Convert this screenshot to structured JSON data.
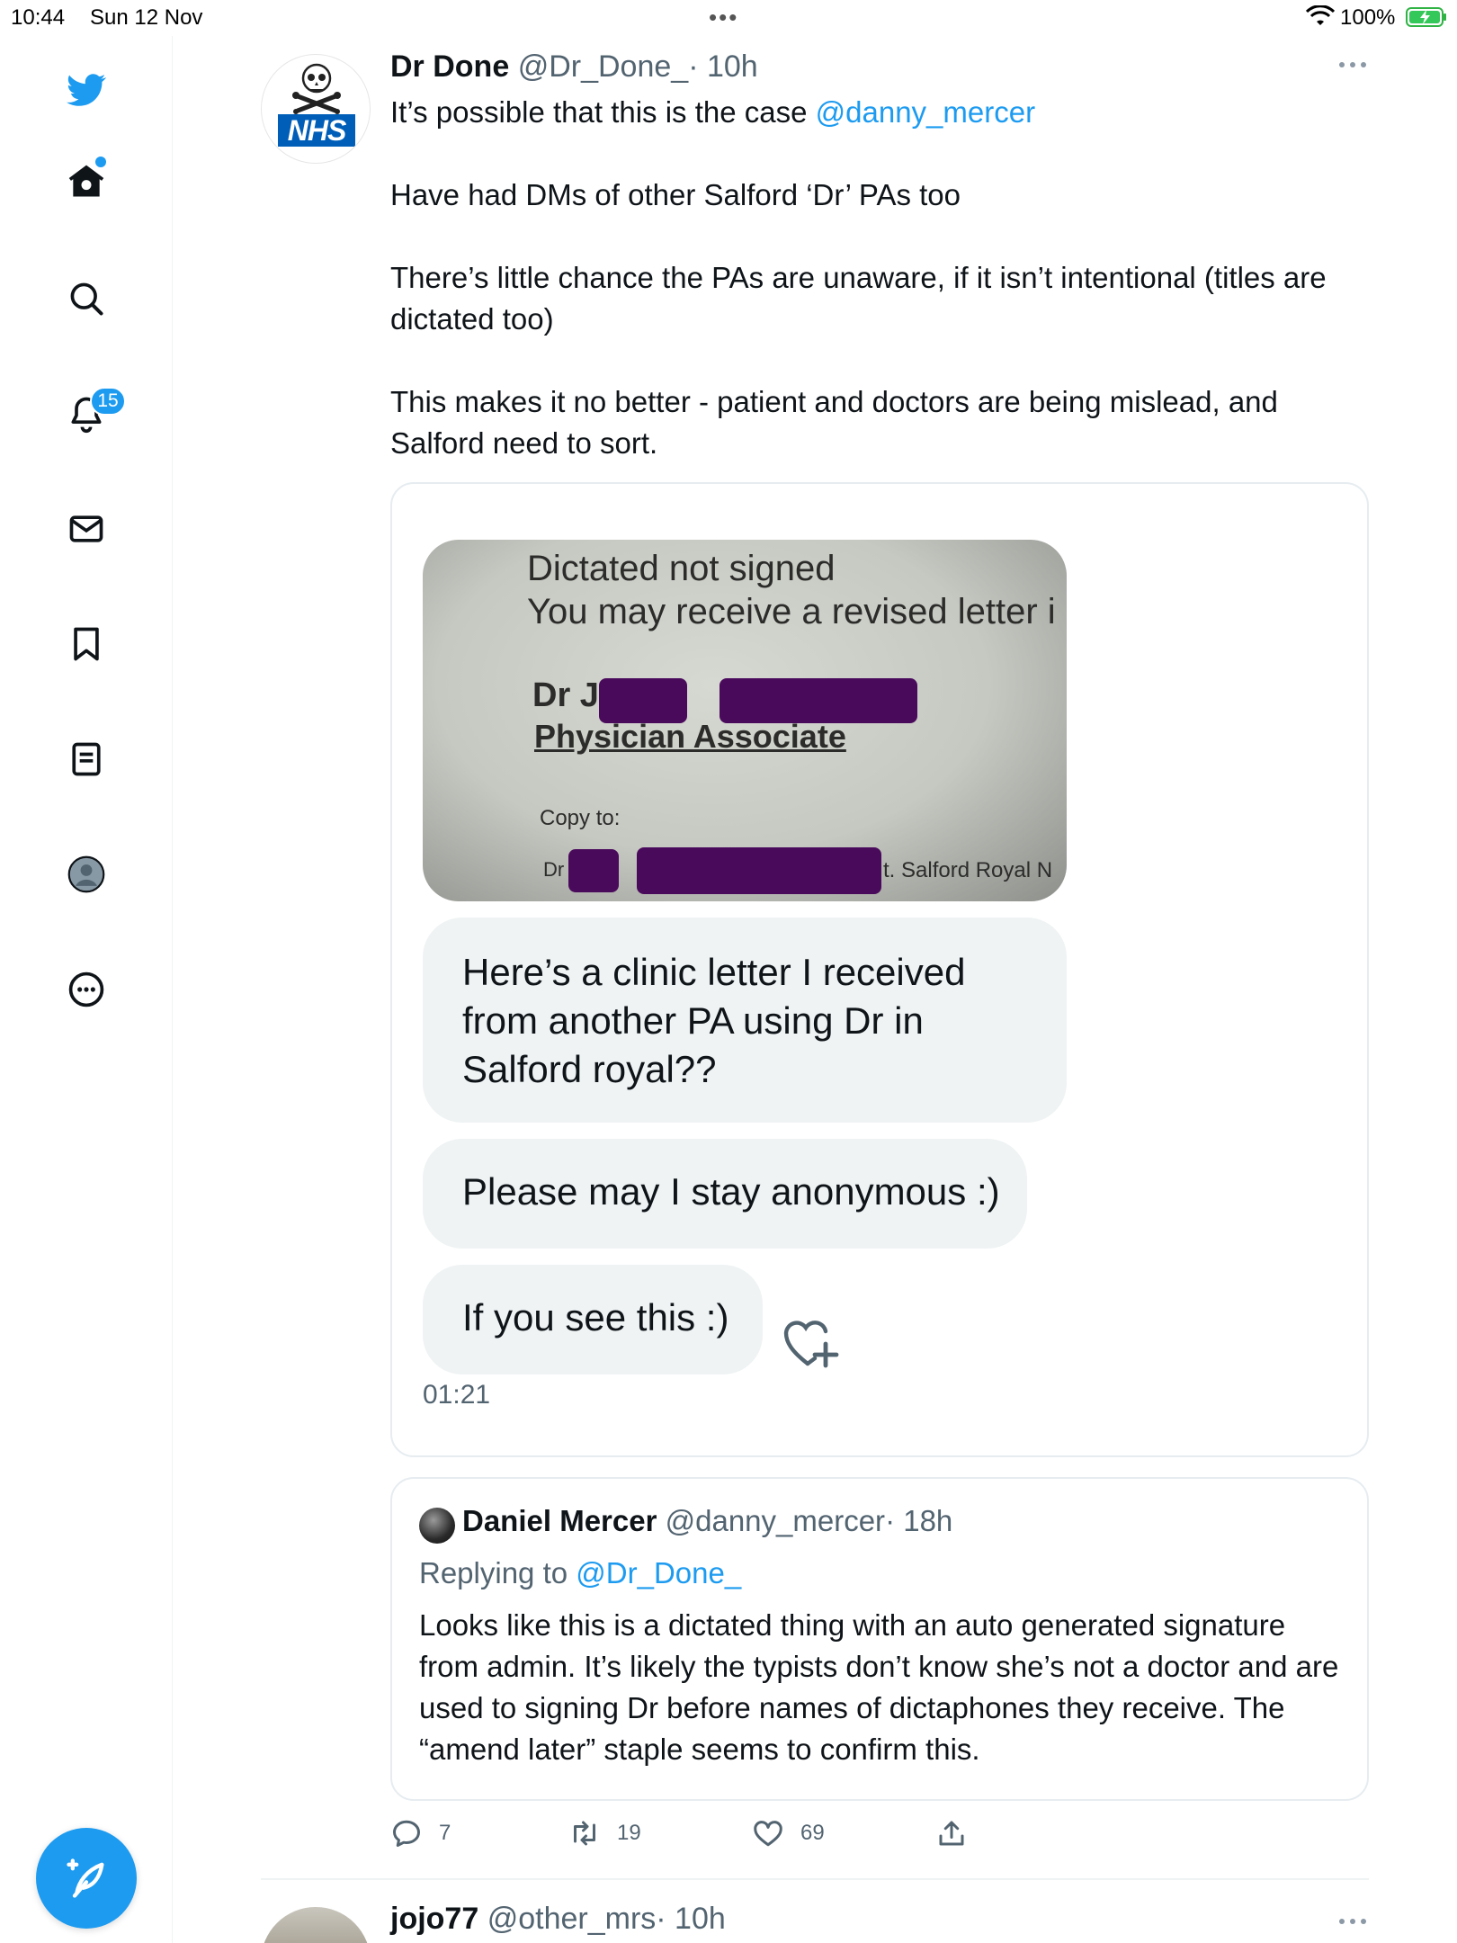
{
  "status_bar": {
    "time": "10:44",
    "date": "Sun 12 Nov",
    "battery": "100%"
  },
  "sidebar": {
    "notification_count": "15",
    "items": [
      {
        "name": "twitter-logo-icon"
      },
      {
        "name": "home-icon"
      },
      {
        "name": "search-icon"
      },
      {
        "name": "notifications-icon"
      },
      {
        "name": "messages-icon"
      },
      {
        "name": "bookmarks-icon"
      },
      {
        "name": "lists-icon"
      },
      {
        "name": "profile-icon"
      },
      {
        "name": "more-icon"
      }
    ],
    "accent_color": "#1d9bf0"
  },
  "tweet": {
    "author_name": "Dr Done",
    "author_handle": "@Dr_Done_",
    "time": "· 10h",
    "avatar_logo_text": "NHS",
    "line1_prefix": "It’s possible that this is the case ",
    "line1_mention": "@danny_mercer",
    "para2": "Have had DMs of other Salford ‘Dr’ PAs too",
    "para3": "There’s little chance the PAs are unaware, if it isn’t intentional (titles are dictated too)",
    "para4": "This makes it no better - patient and doctors are being mislead, and Salford need to sort."
  },
  "media": {
    "letter": {
      "line1": "Dictated not signed",
      "line2": "You may receive a revised letter i",
      "name_prefix": "Dr J",
      "role": "Physician Associate",
      "copy_to": "Copy to:",
      "cc_prefix": "Dr",
      "cc_hospital": "t. Salford Royal N"
    },
    "dm_messages": [
      "Here’s a clinic letter I received from another PA using Dr in Salford royal??",
      "Please may I stay anonymous :)",
      "If you see this :)"
    ],
    "dm_time": "01:21"
  },
  "quote": {
    "author_name": "Daniel Mercer",
    "author_handle": "@danny_mercer",
    "time": "· 18h",
    "replying_prefix": "Replying to ",
    "replying_handle": "@Dr_Done_",
    "body": "Looks like this is a dictated thing with an auto generated signature from admin. It’s likely the typists don’t know she’s not a doctor and are used to signing Dr before names of dictaphones they receive. The “amend later” staple seems to confirm this."
  },
  "actions": {
    "replies": "7",
    "retweets": "19",
    "likes": "69"
  },
  "next_tweet": {
    "author_name": "jojo77",
    "author_handle": "@other_mrs",
    "time": "· 10h"
  }
}
